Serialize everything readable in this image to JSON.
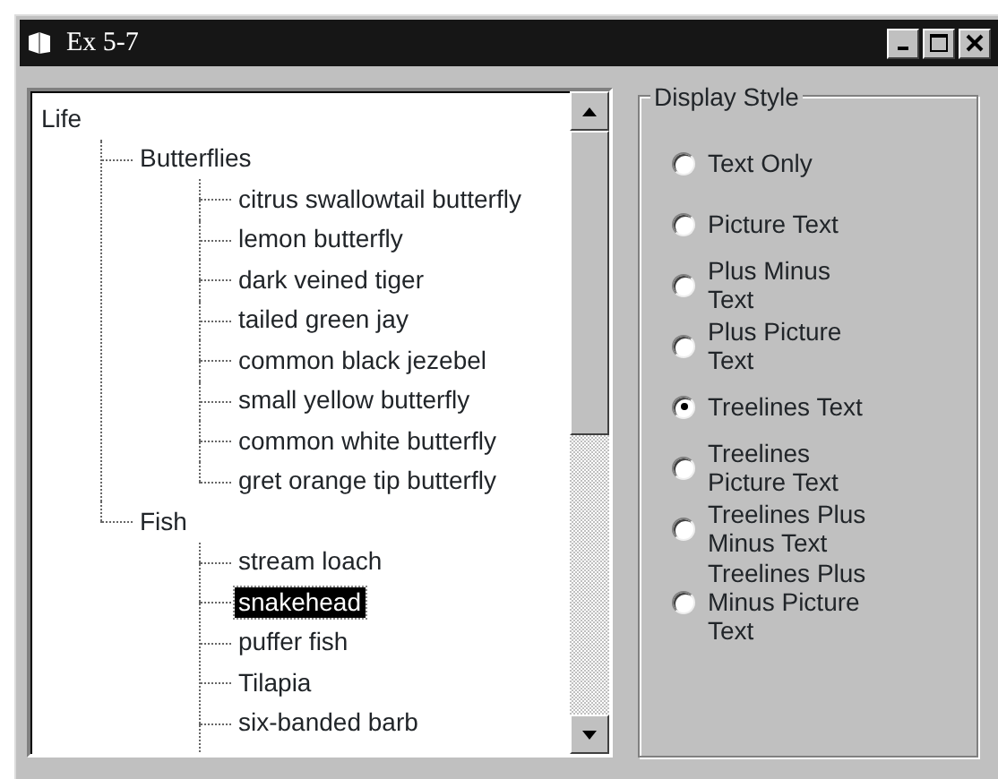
{
  "window": {
    "title": "Ex 5-7"
  },
  "tree": {
    "items": [
      {
        "label": "Life",
        "selected": false,
        "children": [
          {
            "label": "Butterflies",
            "selected": false,
            "children": [
              {
                "label": "citrus swallowtail butterfly",
                "selected": false
              },
              {
                "label": "lemon butterfly",
                "selected": false
              },
              {
                "label": "dark veined tiger",
                "selected": false
              },
              {
                "label": "tailed green jay",
                "selected": false
              },
              {
                "label": "common black jezebel",
                "selected": false
              },
              {
                "label": "small yellow butterfly",
                "selected": false
              },
              {
                "label": "common white butterfly",
                "selected": false
              },
              {
                "label": "gret orange tip butterfly",
                "selected": false
              }
            ]
          },
          {
            "label": "Fish",
            "selected": false,
            "continues": true,
            "children": [
              {
                "label": "stream loach",
                "selected": false
              },
              {
                "label": "snakehead",
                "selected": true
              },
              {
                "label": "puffer fish",
                "selected": false
              },
              {
                "label": "Tilapia",
                "selected": false
              },
              {
                "label": "six-banded barb",
                "selected": false
              }
            ]
          }
        ]
      }
    ]
  },
  "display_style": {
    "title": "Display Style",
    "options": [
      {
        "label": "Text Only",
        "selected": false
      },
      {
        "label": "Picture Text",
        "selected": false
      },
      {
        "label": "Plus Minus\nText",
        "selected": false
      },
      {
        "label": "Plus Picture\nText",
        "selected": false
      },
      {
        "label": "Treelines Text",
        "selected": true
      },
      {
        "label": "Treelines\nPicture Text",
        "selected": false
      },
      {
        "label": "Treelines Plus\nMinus Text",
        "selected": false
      },
      {
        "label": "Treelines Plus\nMinus Picture\nText",
        "selected": false
      }
    ]
  }
}
